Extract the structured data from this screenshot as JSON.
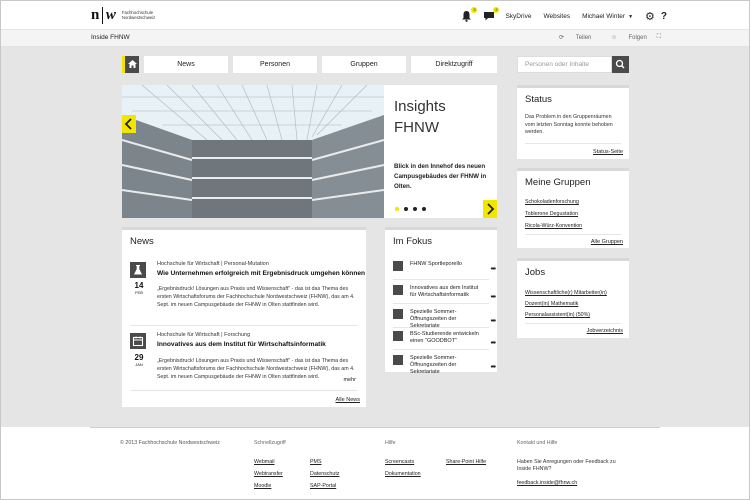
{
  "topbar": {
    "logo_mark_left": "n",
    "logo_mark_right": "w",
    "logo_line1": "Fachhochschule",
    "logo_line2": "Nordwestschweiz",
    "notifications_count": "3",
    "messages_count": "2",
    "skydrive": "SkyDrive",
    "websites": "Websites",
    "user": "Michael Winter",
    "help": "?"
  },
  "subbar": {
    "title": "Inside FHNW",
    "share": "Teilen",
    "follow": "Folgen"
  },
  "nav": {
    "tabs": [
      "News",
      "Personen",
      "Gruppen",
      "Direktzugriff"
    ],
    "search_placeholder": "Personen oder Inhalte"
  },
  "hero": {
    "title_line1": "Insights",
    "title_line2": "FHNW",
    "caption": "Blick in den Innehof des neuen Campusgebäudes der FHNW in Olten."
  },
  "news": {
    "title": "News",
    "items": [
      {
        "meta": "Hochschule für Wirtschaft | Personal-Mutation",
        "headline": "Wie Unternehmen erfolgreich mit Ergebnisdruck umgehen können",
        "day": "14",
        "month": "FEB",
        "body": "„Ergebnisdruck! Lösungen aus Praxis und Wissenschaft\" - das ist das Thema des ersten Wirtschaftsforums der Fachhochschule Nordwestschweiz (FHNW), das am 4. Sept. im neuen Campusgebäude der FHNW in Olten stattfinden wird."
      },
      {
        "meta": "Hochschule für Wirtschaft | Forschung",
        "headline": "Innovatives aus dem Institut für Wirtschaftsinformatik",
        "day": "29",
        "month": "JAN",
        "body": "„Ergebnisdruck! Lösungen aus Praxis und Wissenschaft\" - das ist das Thema des ersten Wirtschaftsforums der Fachhochschule Nordwestschweiz (FHNW), das am 4. Sept. im neuen Campusgebäude der FHNW in Olten stattfinden wird."
      }
    ],
    "more": "mehr",
    "all": "Alle News"
  },
  "focus": {
    "title": "Im Fokus",
    "items": [
      "FHNW Sportleporello",
      "Innovatives aus dem Institut für Wirtschaftsinformatik",
      "Spezielle Sommer-Öffnungszeiten der Sekretariate",
      "BSc-Studierende entwickeln einen \"GOODBOT\"",
      "Spezielle Sommer-Öffnungszeiten der Sekretariate"
    ],
    "dots": "•••"
  },
  "status": {
    "title": "Status",
    "text": "Das Problem in den Gruppenräumen vom letzten Sonntag konnte behoben werden.",
    "link": "Status-Seite"
  },
  "groups": {
    "title": "Meine Gruppen",
    "items": [
      "Schokoladenforschung",
      "Toblerone Degustation",
      "Ricola-Würz-Konvention"
    ],
    "all": "Alle Gruppen"
  },
  "jobs": {
    "title": "Jobs",
    "items": [
      "Wissenschaftliche(r) Mitarbeiter(in)",
      "Dozent(in) Mathematik",
      "Personalassistent(in) (50%)"
    ],
    "all": "Jobverzeichnis"
  },
  "footer": {
    "copyright": "© 2013 Fachhochschule Nordwestschweiz",
    "quick_title": "Schnellzugriff",
    "quick_col1": [
      "Webmail",
      "Webtransfer",
      "Moodle"
    ],
    "quick_col2": [
      "PMS",
      "Datenschutz",
      "SAP-Portal"
    ],
    "help_title": "Hilfe",
    "help_col1": [
      "Screencasts",
      "Dokumentation"
    ],
    "help_col2": [
      "Share-Point Hilfe"
    ],
    "contact_title": "Kontakt und Hilfe",
    "contact_text": "Haben Sie Anregungen oder Feedback zu Inside FHNW?",
    "contact_email": "feedback.inside@fhnw.ch"
  },
  "colors": {
    "accent": "#f2e500",
    "dark": "#4a4a4a",
    "background": "#e5e5e5"
  }
}
